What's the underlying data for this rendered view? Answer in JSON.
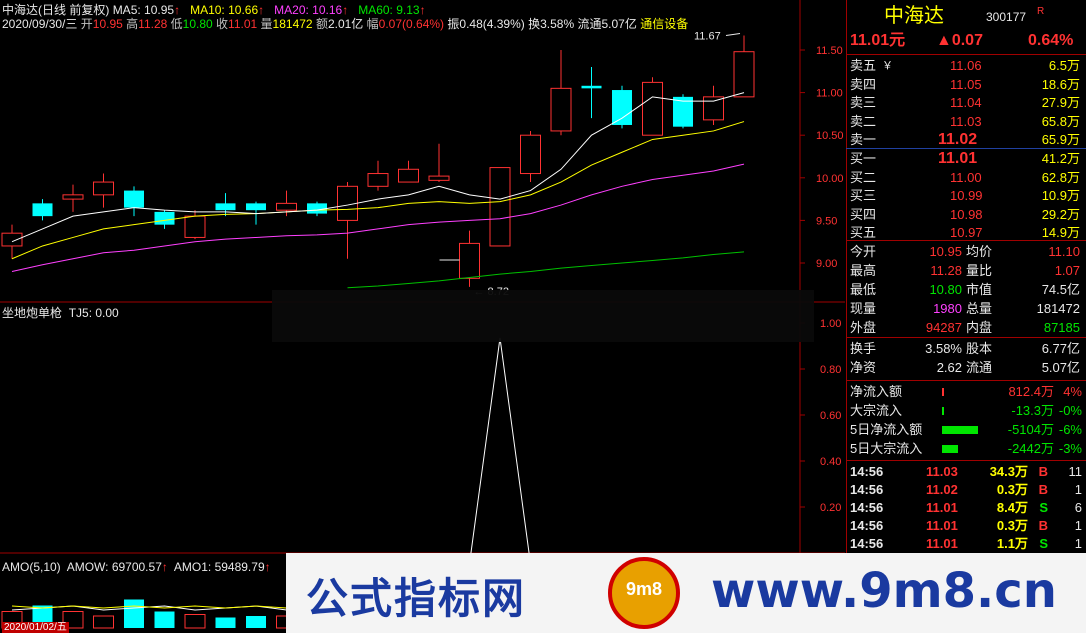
{
  "header": {
    "stock_name": "中海达",
    "chart_mode": "(日线 前复权)",
    "ma5_label": "MA5: 10.95",
    "ma10_label": "MA10: 10.66",
    "ma20_label": "MA20: 10.16",
    "ma60_label": "MA60: 9.13",
    "date": "2020/09/30/三",
    "open_lbl": "开",
    "open_val": "10.95",
    "high_lbl": "高",
    "high_val": "11.28",
    "low_lbl": "低",
    "low_val": "10.80",
    "close_lbl": "收",
    "close_val": "11.01",
    "vol_lbl": "量",
    "vol_val": "181472",
    "amt_lbl": "额",
    "amt_val": "2.01亿",
    "chg_lbl": "幅",
    "chg_val": "0.07(0.64%)",
    "amp": "振0.48(4.39%)",
    "turnover": "换3.58%",
    "float_cap": "流通5.07亿",
    "sector": "通信设备",
    "arrow": "↑"
  },
  "price_axis": [
    "11.50",
    "11.00",
    "10.50",
    "10.00",
    "9.50",
    "9.00"
  ],
  "annotations": {
    "high_mark": "11.67",
    "low_mark": "8.72"
  },
  "indicator": {
    "name": "坐地炮单枪",
    "value_label": "TJ5: 0.00",
    "axis": [
      "1.00",
      "0.80",
      "0.60",
      "0.40",
      "0.20"
    ]
  },
  "volume": {
    "label_name": "AMO(5,10)",
    "amow": "AMOW: 69700.57",
    "amo1": "AMO1: 59489.79",
    "arrow": "↑",
    "date_label": "2020/01/02/五"
  },
  "quote": {
    "name": "中海达",
    "code": "300177",
    "flag": "R",
    "price": "11.01元",
    "change": "▲0.07",
    "pct": "0.64%",
    "sells": [
      {
        "label": "卖五",
        "mark": "￥",
        "price": "11.06",
        "vol": "6.5万"
      },
      {
        "label": "卖四",
        "mark": "",
        "price": "11.05",
        "vol": "18.6万"
      },
      {
        "label": "卖三",
        "mark": "",
        "price": "11.04",
        "vol": "27.9万"
      },
      {
        "label": "卖二",
        "mark": "",
        "price": "11.03",
        "vol": "65.8万"
      },
      {
        "label": "卖一",
        "mark": "",
        "price": "11.02",
        "vol": "65.9万"
      }
    ],
    "buys": [
      {
        "label": "买一",
        "price": "11.01",
        "vol": "41.2万"
      },
      {
        "label": "买二",
        "price": "11.00",
        "vol": "62.8万"
      },
      {
        "label": "买三",
        "price": "10.99",
        "vol": "10.9万"
      },
      {
        "label": "买四",
        "price": "10.98",
        "vol": "29.2万"
      },
      {
        "label": "买五",
        "price": "10.97",
        "vol": "14.9万"
      }
    ],
    "stats": [
      {
        "l1": "今开",
        "v1": "10.95",
        "c1": "red",
        "l2": "均价",
        "v2": "11.10",
        "c2": "red"
      },
      {
        "l1": "最高",
        "v1": "11.28",
        "c1": "red",
        "l2": "量比",
        "v2": "1.07",
        "c2": "red"
      },
      {
        "l1": "最低",
        "v1": "10.80",
        "c1": "green",
        "l2": "市值",
        "v2": "74.5亿",
        "c2": "white"
      },
      {
        "l1": "现量",
        "v1": "1980",
        "c1": "magenta",
        "l2": "总量",
        "v2": "181472",
        "c2": "white"
      },
      {
        "l1": "外盘",
        "v1": "94287",
        "c1": "red",
        "l2": "内盘",
        "v2": "87185",
        "c2": "green"
      }
    ],
    "stats2": [
      {
        "l1": "换手",
        "v1": "3.58%",
        "l2": "股本",
        "v2": "6.77亿"
      },
      {
        "l1": "净资",
        "v1": "2.62",
        "l2": "流通",
        "v2": "5.07亿"
      }
    ],
    "flows": [
      {
        "label": "净流入额",
        "value": "812.4万",
        "pct": "4%",
        "color": "red",
        "bar": 0.05
      },
      {
        "label": "大宗流入",
        "value": "-13.3万",
        "pct": "-0%",
        "color": "green",
        "bar": 0.01
      },
      {
        "label": "5日净流入额",
        "value": "-5104万",
        "pct": "-6%",
        "color": "green",
        "bar": 0.9
      },
      {
        "label": "5日大宗流入",
        "value": "-2442万",
        "pct": "-3%",
        "color": "green",
        "bar": 0.4
      }
    ],
    "ticks": [
      {
        "time": "14:56",
        "price": "11.03",
        "vol": "34.3万",
        "side": "B",
        "n": "11"
      },
      {
        "time": "14:56",
        "price": "11.02",
        "vol": "0.3万",
        "side": "B",
        "n": "1"
      },
      {
        "time": "14:56",
        "price": "11.01",
        "vol": "8.4万",
        "side": "S",
        "n": "6"
      },
      {
        "time": "14:56",
        "price": "11.01",
        "vol": "0.3万",
        "side": "B",
        "n": "1"
      },
      {
        "time": "14:56",
        "price": "11.01",
        "vol": "1.1万",
        "side": "S",
        "n": "1"
      }
    ]
  },
  "watermark": {
    "title": "公式指标网",
    "domain": "www.9m8.cn",
    "logo_text": "9m8"
  },
  "colors": {
    "up": "#ff3232",
    "down": "#00ffff",
    "ma5": "#ffffff",
    "ma10": "#ffff00",
    "ma20": "#ff40ff",
    "ma60": "#00c000"
  },
  "chart_data": {
    "type": "candlestick",
    "ylim": [
      8.72,
      11.67
    ],
    "candles": [
      {
        "o": 9.2,
        "c": 9.35,
        "h": 9.45,
        "l": 9.05
      },
      {
        "o": 9.7,
        "c": 9.55,
        "h": 9.75,
        "l": 9.5
      },
      {
        "o": 9.75,
        "c": 9.8,
        "h": 9.92,
        "l": 9.6
      },
      {
        "o": 9.8,
        "c": 9.95,
        "h": 10.05,
        "l": 9.65
      },
      {
        "o": 9.85,
        "c": 9.65,
        "h": 9.9,
        "l": 9.55
      },
      {
        "o": 9.6,
        "c": 9.45,
        "h": 9.62,
        "l": 9.4
      },
      {
        "o": 9.3,
        "c": 9.55,
        "h": 9.62,
        "l": 9.28
      },
      {
        "o": 9.7,
        "c": 9.62,
        "h": 9.82,
        "l": 9.55
      },
      {
        "o": 9.7,
        "c": 9.62,
        "h": 9.72,
        "l": 9.45
      },
      {
        "o": 9.62,
        "c": 9.7,
        "h": 9.85,
        "l": 9.55
      },
      {
        "o": 9.7,
        "c": 9.58,
        "h": 9.72,
        "l": 9.55
      },
      {
        "o": 9.5,
        "c": 9.9,
        "h": 9.95,
        "l": 9.05
      },
      {
        "o": 9.9,
        "c": 10.05,
        "h": 10.2,
        "l": 9.85
      },
      {
        "o": 9.95,
        "c": 10.1,
        "h": 10.2,
        "l": 9.95
      },
      {
        "o": 9.97,
        "c": 10.02,
        "h": 10.4,
        "l": 9.95
      },
      {
        "o": 8.82,
        "c": 9.23,
        "h": 9.38,
        "l": 8.72
      },
      {
        "o": 9.2,
        "c": 10.12,
        "h": 10.12,
        "l": 9.2
      },
      {
        "o": 10.05,
        "c": 10.5,
        "h": 10.55,
        "l": 9.95
      },
      {
        "o": 10.55,
        "c": 11.05,
        "h": 11.5,
        "l": 10.5
      },
      {
        "o": 11.08,
        "c": 11.05,
        "h": 11.3,
        "l": 10.7
      },
      {
        "o": 11.03,
        "c": 10.62,
        "h": 11.08,
        "l": 10.58
      },
      {
        "o": 10.5,
        "c": 11.12,
        "h": 11.18,
        "l": 10.5
      },
      {
        "o": 10.95,
        "c": 10.6,
        "h": 10.98,
        "l": 10.58
      },
      {
        "o": 10.68,
        "c": 10.95,
        "h": 11.08,
        "l": 10.62
      },
      {
        "o": 10.95,
        "c": 11.48,
        "h": 11.67,
        "l": 10.95
      }
    ],
    "ma5": [
      9.25,
      9.4,
      9.55,
      9.6,
      9.65,
      9.62,
      9.6,
      9.6,
      9.58,
      9.6,
      9.62,
      9.68,
      9.75,
      9.8,
      9.9,
      9.8,
      9.75,
      9.85,
      10.1,
      10.5,
      10.7,
      10.95,
      10.9,
      10.9,
      11.0
    ],
    "ma10": [
      9.05,
      9.2,
      9.3,
      9.4,
      9.45,
      9.5,
      9.55,
      9.57,
      9.58,
      9.6,
      9.62,
      9.63,
      9.65,
      9.7,
      9.72,
      9.7,
      9.72,
      9.8,
      9.95,
      10.15,
      10.3,
      10.45,
      10.5,
      10.55,
      10.66
    ],
    "ma20": [
      8.9,
      8.98,
      9.05,
      9.12,
      9.15,
      9.2,
      9.25,
      9.28,
      9.3,
      9.32,
      9.33,
      9.35,
      9.4,
      9.45,
      9.48,
      9.5,
      9.52,
      9.58,
      9.68,
      9.8,
      9.9,
      9.98,
      10.03,
      10.08,
      10.16
    ],
    "ma60": [
      null,
      null,
      null,
      null,
      null,
      null,
      null,
      null,
      null,
      null,
      null,
      8.71,
      8.73,
      8.76,
      8.79,
      8.83,
      8.87,
      8.9,
      8.94,
      8.97,
      9.0,
      9.03,
      9.06,
      9.1,
      9.13
    ],
    "indicator": [
      0,
      0,
      0,
      0,
      0,
      0,
      0,
      0,
      0,
      0,
      0,
      0,
      0,
      0,
      0,
      0,
      1,
      0,
      0,
      0,
      0,
      0,
      0,
      0,
      0
    ],
    "volume": [
      0.55,
      0.75,
      0.55,
      0.4,
      0.95,
      0.55,
      0.45,
      0.35,
      0.4,
      0.4,
      0.35,
      0.5
    ]
  }
}
